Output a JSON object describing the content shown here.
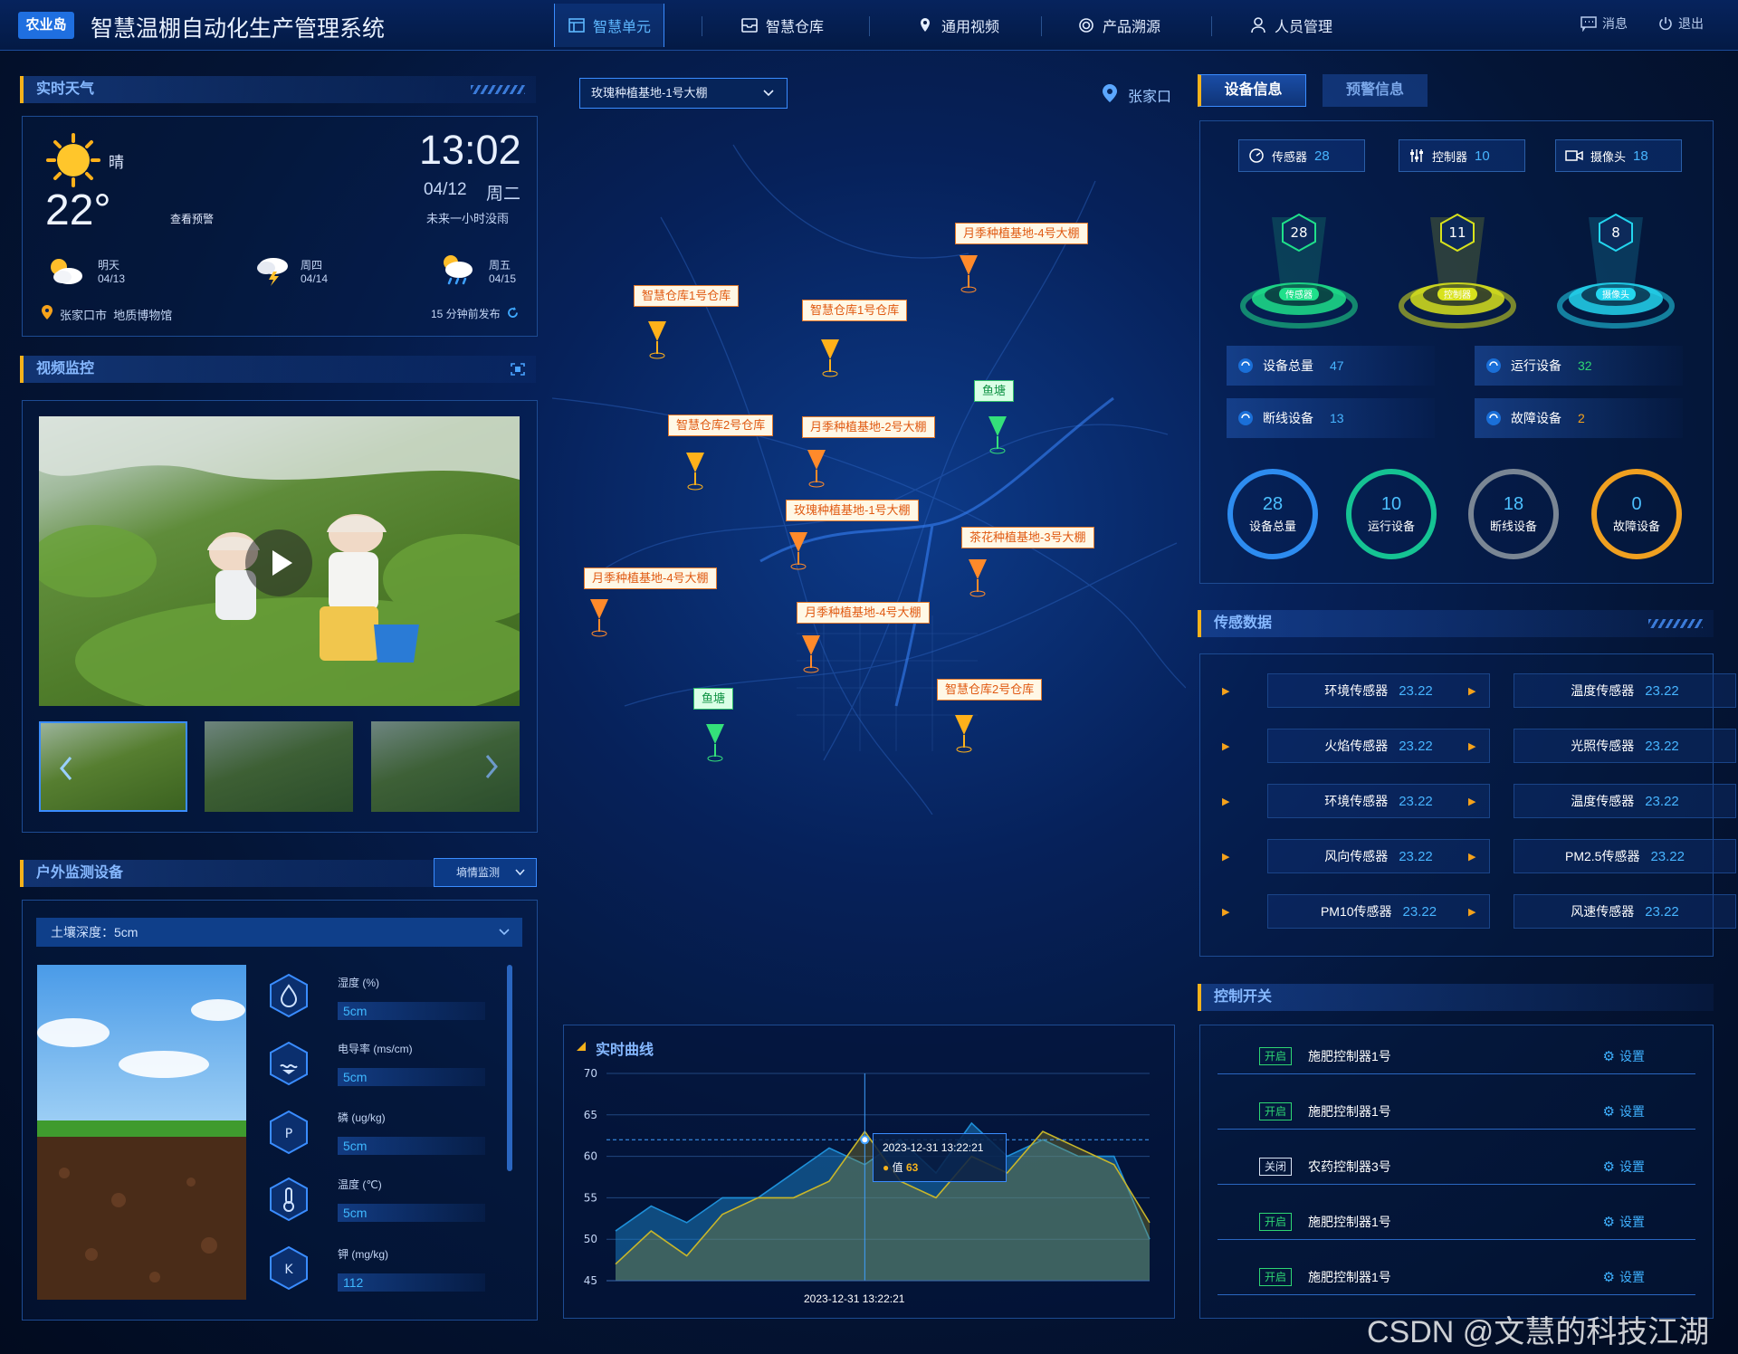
{
  "header": {
    "logo": "农业岛",
    "title": "智慧温棚自动化生产管理系统",
    "nav": [
      {
        "label": "智慧单元",
        "icon": "dashboard-icon"
      },
      {
        "label": "智慧仓库",
        "icon": "inbox-icon"
      },
      {
        "label": "通用视频",
        "icon": "location-icon"
      },
      {
        "label": "产品溯源",
        "icon": "target-icon"
      },
      {
        "label": "人员管理",
        "icon": "user-icon"
      }
    ],
    "messages": "消息",
    "logout": "退出"
  },
  "weather": {
    "title": "实时天气",
    "condition": "晴",
    "temp": "22°",
    "view_warning": "查看预警",
    "time": "13:02",
    "date": "04/12",
    "weekday": "周二",
    "hint": "未来一小时没雨",
    "forecast": [
      {
        "day": "明天",
        "date": "04/13",
        "icon": "partly-cloudy-icon"
      },
      {
        "day": "周四",
        "date": "04/14",
        "icon": "thunder-icon"
      },
      {
        "day": "周五",
        "date": "04/15",
        "icon": "rain-icon"
      }
    ],
    "location": "张家口市  地质博物馆",
    "published": "15 分钟前发布"
  },
  "video": {
    "title": "视频监控"
  },
  "outdoor": {
    "title": "户外监测设备",
    "dropdown": "墒情监测",
    "depth": "土壤深度：5cm",
    "metrics": [
      {
        "label": "湿度 (%)",
        "value": "5cm",
        "icon": "humidity-icon"
      },
      {
        "label": "电导率 (ms/cm)",
        "value": "5cm",
        "icon": "conductivity-icon"
      },
      {
        "label": "磷 (ug/kg)",
        "value": "5cm",
        "icon": "phosphorus-icon"
      },
      {
        "label": "温度 (℃)",
        "value": "5cm",
        "icon": "thermometer-icon"
      },
      {
        "label": "钾 (mg/kg)",
        "value": "112",
        "icon": "potassium-icon"
      }
    ]
  },
  "map": {
    "select": "玫瑰种植基地-1号大棚",
    "city": "张家口",
    "markers": [
      "月季种植基地-4号大棚",
      "智慧仓库1号仓库",
      "智慧仓库1号仓库",
      "鱼塘",
      "智慧仓库2号仓库",
      "月季种植基地-2号大棚",
      "玫瑰种植基地-1号大棚",
      "茶花种植基地-3号大棚",
      "月季种植基地-4号大棚",
      "月季种植基地-4号大棚",
      "鱼塘",
      "智慧仓库2号仓库"
    ]
  },
  "chart": {
    "title": "实时曲线",
    "tooltip_time": "2023-12-31 13:22:21",
    "tooltip_label": "值",
    "tooltip_value": "63",
    "xlabel": "2023-12-31 13:22:21"
  },
  "chart_data": {
    "type": "area",
    "ylim": [
      45,
      70
    ],
    "yticks": [
      70,
      65,
      60,
      55,
      50,
      45
    ],
    "reference_line": 62,
    "series": [
      {
        "values": [
          51,
          54,
          52,
          55,
          55,
          58,
          61,
          59,
          62,
          58,
          64,
          60,
          62,
          60,
          60,
          50
        ]
      },
      {
        "values": [
          47,
          51,
          48,
          53,
          55,
          55,
          57,
          63,
          57,
          55,
          60,
          58,
          63,
          61,
          59,
          52
        ]
      }
    ],
    "highlight": {
      "index": 7,
      "value": 63
    }
  },
  "device": {
    "tabs": [
      "设备信息",
      "预警信息"
    ],
    "counts": [
      {
        "label": "传感器",
        "value": "28",
        "icon": "gauge-icon"
      },
      {
        "label": "控制器",
        "value": "10",
        "icon": "sliders-icon"
      },
      {
        "label": "摄像头",
        "value": "18",
        "icon": "camera-icon"
      }
    ],
    "pedestals": [
      {
        "value": "28",
        "label": "传感器",
        "color": "#1fe08a"
      },
      {
        "value": "11",
        "label": "控制器",
        "color": "#d8e21c"
      },
      {
        "value": "8",
        "label": "摄像头",
        "color": "#23d5ee"
      }
    ],
    "rows": [
      {
        "label": "设备总量",
        "value": "47"
      },
      {
        "label": "运行设备",
        "value": "32"
      },
      {
        "label": "断线设备",
        "value": "13"
      },
      {
        "label": "故障设备",
        "value": "2"
      }
    ],
    "rings": [
      {
        "value": "28",
        "label": "设备总量",
        "color": "#2d8cf0"
      },
      {
        "value": "10",
        "label": "运行设备",
        "color": "#15c393"
      },
      {
        "value": "18",
        "label": "断线设备",
        "color": "#7a8694"
      },
      {
        "value": "0",
        "label": "故障设备",
        "color": "#f0a020"
      }
    ]
  },
  "sensors": {
    "title": "传感数据",
    "items": [
      {
        "name": "环境传感器",
        "value": "23.22"
      },
      {
        "name": "温度传感器",
        "value": "23.22"
      },
      {
        "name": "火焰传感器",
        "value": "23.22"
      },
      {
        "name": "光照传感器",
        "value": "23.22"
      },
      {
        "name": "环境传感器",
        "value": "23.22"
      },
      {
        "name": "温度传感器",
        "value": "23.22"
      },
      {
        "name": "风向传感器",
        "value": "23.22"
      },
      {
        "name": "PM2.5传感器",
        "value": "23.22"
      },
      {
        "name": "PM10传感器",
        "value": "23.22"
      },
      {
        "name": "风速传感器",
        "value": "23.22"
      }
    ]
  },
  "switches": {
    "title": "控制开关",
    "setting": "设置",
    "items": [
      {
        "state": "开启",
        "on": true,
        "name": "施肥控制器1号"
      },
      {
        "state": "开启",
        "on": true,
        "name": "施肥控制器1号"
      },
      {
        "state": "关闭",
        "on": false,
        "name": "农药控制器3号"
      },
      {
        "state": "开启",
        "on": true,
        "name": "施肥控制器1号"
      },
      {
        "state": "开启",
        "on": true,
        "name": "施肥控制器1号"
      }
    ]
  },
  "watermark": "CSDN @文慧的科技江湖"
}
